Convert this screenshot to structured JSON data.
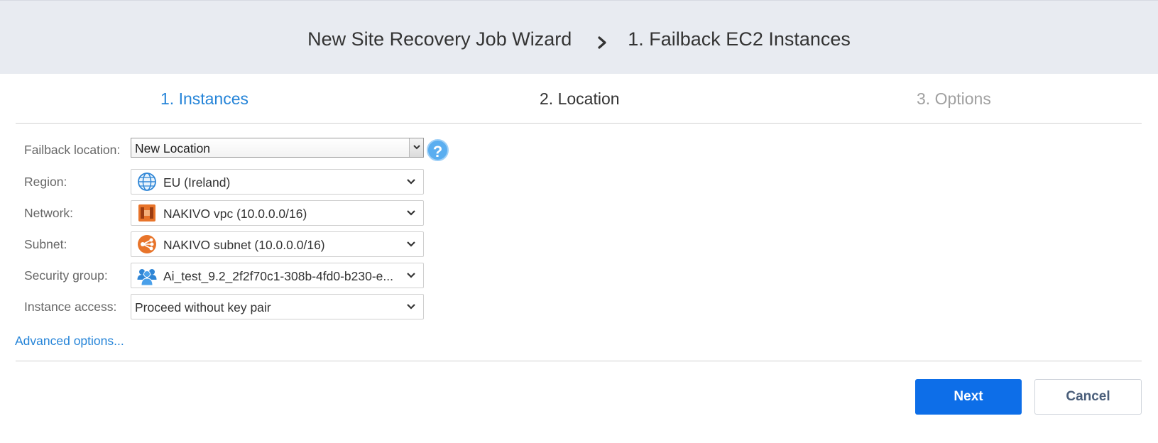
{
  "header": {
    "wizard_title": "New Site Recovery Job Wizard",
    "current_page": "1. Failback EC2 Instances"
  },
  "steps": [
    {
      "label": "1. Instances",
      "state": "completed"
    },
    {
      "label": "2. Location",
      "state": "active"
    },
    {
      "label": "3. Options",
      "state": "pending"
    }
  ],
  "form": {
    "failback_location": {
      "label": "Failback location:",
      "value": "New Location"
    },
    "region": {
      "label": "Region:",
      "value": "EU (Ireland)",
      "icon": "globe-icon"
    },
    "network": {
      "label": "Network:",
      "value": "NAKIVO vpc (10.0.0.0/16)",
      "icon": "aws-vpc-icon"
    },
    "subnet": {
      "label": "Subnet:",
      "value": "NAKIVO subnet (10.0.0.0/16)",
      "icon": "subnet-icon"
    },
    "security_group": {
      "label": "Security group:",
      "value": "Ai_test_9.2_2f2f70c1-308b-4fd0-b230-e...",
      "icon": "users-group-icon"
    },
    "instance_access": {
      "label": "Instance access:",
      "value": "Proceed without key pair"
    }
  },
  "help_glyph": "?",
  "advanced_options_label": "Advanced options...",
  "buttons": {
    "next": "Next",
    "cancel": "Cancel"
  },
  "colors": {
    "accent": "#2584d8",
    "primary_button": "#0d6ee8",
    "header_bg": "#e8ebf1",
    "step_pending": "#a0a0a0",
    "aws_orange": "#e8742a"
  }
}
